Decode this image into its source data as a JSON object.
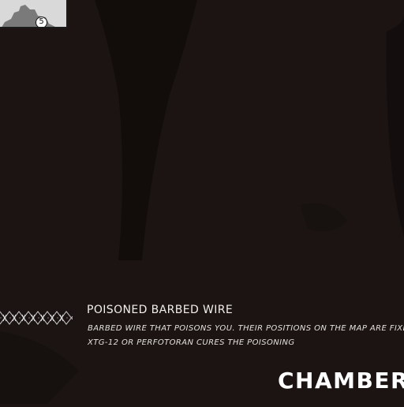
{
  "minimap": {
    "marker_number": "5",
    "marker_icon": "location-marker-icon"
  },
  "item": {
    "icon": "barbed-wire-icon",
    "title": "POISONED BARBED WIRE",
    "description_lines": [
      "BARBED WIRE THAT POISONS YOU. THEIR POSITIONS ON THE MAP ARE FIXED",
      "XTG-12 OR PERFOTORAN CURES THE POISONING"
    ]
  },
  "location": {
    "name": "CHAMBER"
  },
  "colors": {
    "background": "#1b1413",
    "text": "#f1eeec",
    "minimap": "#d9d9d9"
  }
}
